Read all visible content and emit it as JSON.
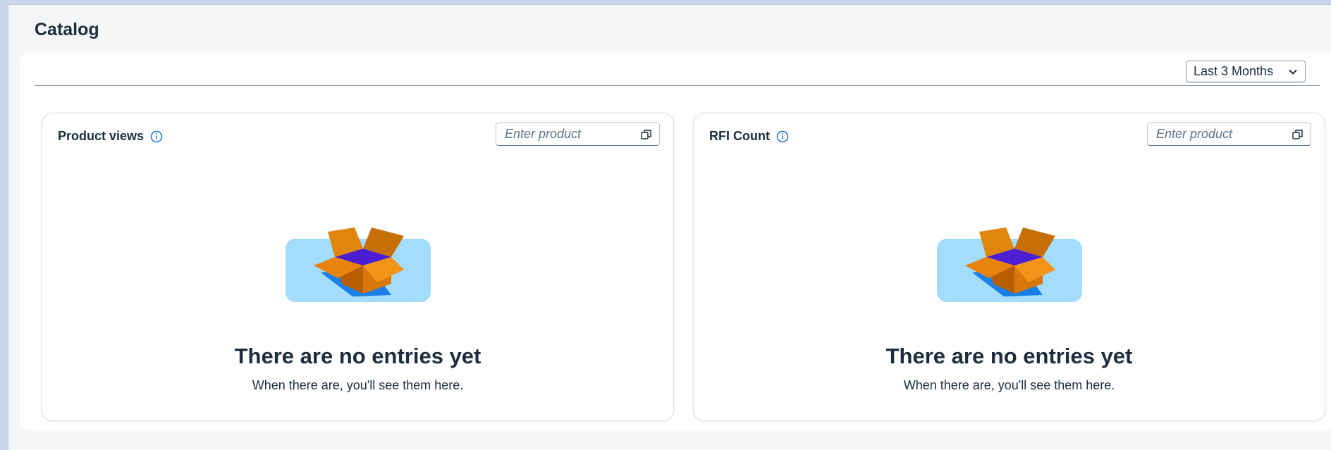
{
  "page": {
    "title": "Catalog"
  },
  "filter": {
    "selected": "Last 3 Months"
  },
  "cards": [
    {
      "title": "Product views",
      "input_placeholder": "Enter product",
      "empty_title": "There are no entries yet",
      "empty_subtitle": "When there are, you'll see them here."
    },
    {
      "title": "RFI Count",
      "input_placeholder": "Enter product",
      "empty_title": "There are no entries yet",
      "empty_subtitle": "When there are, you'll see them here."
    }
  ],
  "icons": {
    "info": "info-icon",
    "value_help": "value-help-icon",
    "dropdown": "chevron-down-icon"
  },
  "colors": {
    "accent": "#0a6ed1",
    "background": "#f5f6f7",
    "text": "#1d2d3e",
    "illustration_bg": "#a3dcfc"
  }
}
